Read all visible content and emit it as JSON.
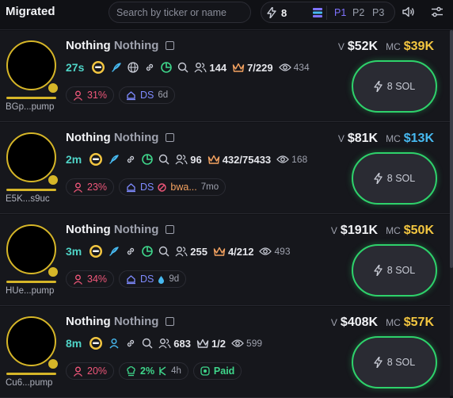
{
  "header": {
    "title": "Migrated",
    "search_placeholder": "Search by ticker or name",
    "quick_buy_amount": "8",
    "presets": [
      "P1",
      "P2",
      "P3"
    ],
    "active_preset": "P1"
  },
  "labels": {
    "volume": "V",
    "market_cap": "MC",
    "buy_unit": "SOL"
  },
  "tokens": [
    {
      "name": "Nothing",
      "ticker": "Nothing",
      "address": "BGp...pump",
      "age": "27s",
      "holders": "144",
      "top_holders": "7/229",
      "views": "434",
      "pct": "31%",
      "ds_label": "DS",
      "ds_age": "6d",
      "volume": "$52K",
      "market_cap": "$39K",
      "mc_color": "yellow",
      "buy_amount": "8 SOL"
    },
    {
      "name": "Nothing",
      "ticker": "Nothing",
      "address": "E5K...s9uc",
      "age": "2m",
      "holders": "96",
      "top_holders": "432/75433",
      "views": "168",
      "pct": "23%",
      "ds_label": "DS",
      "extra_label": "bwa...",
      "ds_age": "7mo",
      "volume": "$81K",
      "market_cap": "$13K",
      "mc_color": "blue",
      "buy_amount": "8 SOL"
    },
    {
      "name": "Nothing",
      "ticker": "Nothing",
      "address": "HUe...pump",
      "age": "3m",
      "holders": "255",
      "top_holders": "4/212",
      "views": "493",
      "pct": "34%",
      "ds_label": "DS",
      "ds_age": "9d",
      "volume": "$191K",
      "market_cap": "$50K",
      "mc_color": "yellow",
      "buy_amount": "8 SOL"
    },
    {
      "name": "Nothing",
      "ticker": "Nothing",
      "address": "Cu6...pump",
      "age": "8m",
      "holders": "683",
      "top_holders": "1/2",
      "views": "599",
      "pct": "20%",
      "bundle_pct": "2%",
      "bundle_age": "4h",
      "paid_label": "Paid",
      "volume": "$408K",
      "market_cap": "$57K",
      "mc_color": "yellow",
      "buy_amount": "8 SOL"
    }
  ],
  "colors": {
    "accent_green": "#2ed26b",
    "accent_teal": "#4fd4c7",
    "mc_yellow": "#f3c640",
    "mc_blue": "#47b9f0",
    "preset_active": "#7f73ff",
    "danger_pink": "#f0577a",
    "avatar_ring": "#d6b628"
  },
  "icons": [
    "bolt-icon",
    "stack-icon",
    "volume-icon",
    "sliders-icon",
    "copy-icon",
    "feather-icon",
    "globe-icon",
    "link-icon",
    "pie-icon",
    "search-icon",
    "users-icon",
    "crown-icon",
    "eye-icon",
    "user-icon",
    "hat-icon",
    "pill-icon",
    "chef-hat-icon"
  ]
}
